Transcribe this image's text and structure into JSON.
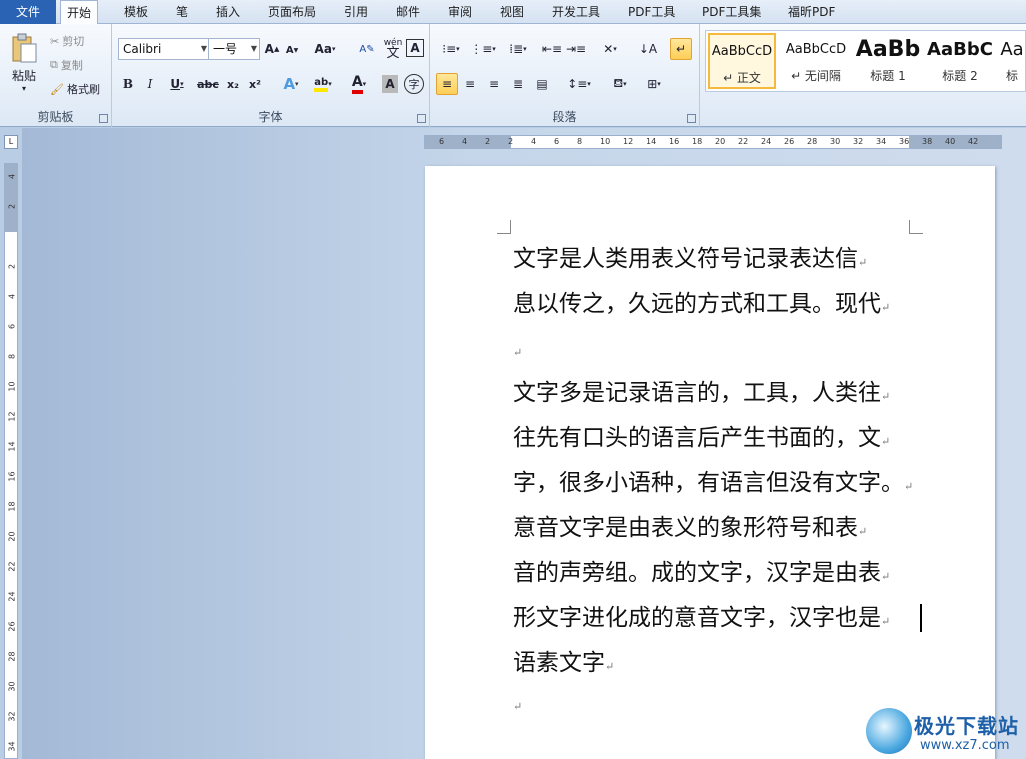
{
  "menu": {
    "items": [
      "文件",
      "开始",
      "模板",
      "笔",
      "插入",
      "页面布局",
      "引用",
      "邮件",
      "审阅",
      "视图",
      "开发工具",
      "PDF工具",
      "PDF工具集",
      "福昕PDF"
    ]
  },
  "clipboard": {
    "paste": "粘贴",
    "cut": "剪切",
    "copy": "复制",
    "format_painter": "格式刷",
    "label": "剪贴板"
  },
  "font": {
    "family": "Calibri",
    "size": "一号",
    "grow": "A",
    "shrink": "A",
    "change_case": "Aa",
    "clear_format": "A",
    "phonetic": "wén",
    "bold": "B",
    "italic": "I",
    "underline": "U",
    "strike": "abc",
    "sub": "x₂",
    "sup": "x²",
    "effects": "A",
    "highlight": "ab",
    "color": "A",
    "shade": "A",
    "enclose": "字",
    "label": "字体"
  },
  "paragraph": {
    "label": "段落"
  },
  "styles": {
    "items": [
      {
        "preview": "AaBbCcD",
        "name": "↵ 正文"
      },
      {
        "preview": "AaBbCcD",
        "name": "↵ 无间隔"
      },
      {
        "preview": "AaBb",
        "name": "标题 1"
      },
      {
        "preview": "AaBbC",
        "name": "标题 2"
      },
      {
        "preview": "Aa",
        "name": "标"
      }
    ]
  },
  "ruler": {
    "h_ticks": [
      "6",
      "4",
      "2",
      "2",
      "4",
      "6",
      "8",
      "10",
      "12",
      "14",
      "16",
      "18",
      "20",
      "22",
      "24",
      "26",
      "28",
      "30",
      "32",
      "34",
      "36",
      "38",
      "40",
      "42"
    ],
    "v_ticks": [
      "4",
      "2",
      "2",
      "4",
      "6",
      "8",
      "10",
      "12",
      "14",
      "16",
      "18",
      "20",
      "22",
      "24",
      "26",
      "28",
      "30",
      "32",
      "34"
    ]
  },
  "document": {
    "lines": [
      "文字是人类用表义符号记录表达信",
      "息以传之，久远的方式和工具。现代",
      "",
      "文字多是记录语言的，工具，人类往",
      "往先有口头的语言后产生书面的，文",
      "字，很多小语种，有语言但没有文字。",
      "意音文字是由表义的象形符号和表",
      "音的声旁组。成的文字，汉字是由表",
      "形文字进化成的意音文字，汉字也是",
      "语素文字",
      ""
    ],
    "paragraph_mark": "↵"
  },
  "watermark": {
    "title": "极光下载站",
    "url": "www.xz7.com"
  }
}
